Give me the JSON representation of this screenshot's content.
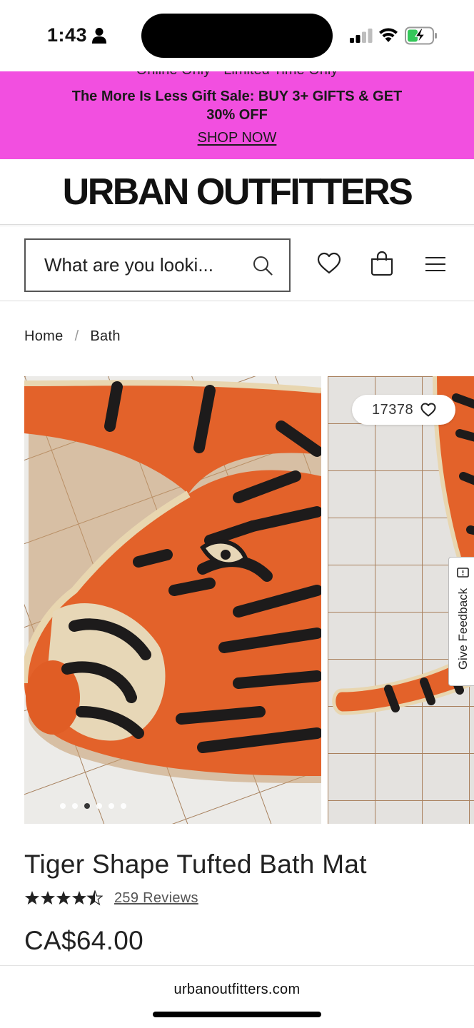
{
  "status_bar": {
    "time": "1:43",
    "icons": [
      "person-icon",
      "signal-icon",
      "wifi-icon",
      "battery-charging-icon"
    ]
  },
  "promo": {
    "top_text": "Online Only • Limited Time Only",
    "main_text": "The More Is Less Gift Sale: BUY 3+ GIFTS & GET 30% OFF",
    "link_text": "SHOP NOW",
    "background_color": "#f24fe0"
  },
  "logo": {
    "text": "URBAN OUTFITTERS"
  },
  "header": {
    "search": {
      "placeholder": "What are you looki..."
    },
    "icons": [
      "search-icon",
      "heart-icon",
      "bag-icon",
      "menu-icon"
    ]
  },
  "breadcrumb": {
    "items": [
      "Home",
      "Bath"
    ],
    "separator": "/"
  },
  "gallery": {
    "slide_count": 6,
    "active_index": 2,
    "wishlist_count": "17378"
  },
  "feedback": {
    "label": "Give Feedback"
  },
  "product": {
    "title": "Tiger Shape Tufted Bath Mat",
    "rating": 4.5,
    "reviews_text": "259 Reviews",
    "price": "CA$64.00"
  },
  "browser": {
    "url": "urbanoutfitters.com"
  }
}
